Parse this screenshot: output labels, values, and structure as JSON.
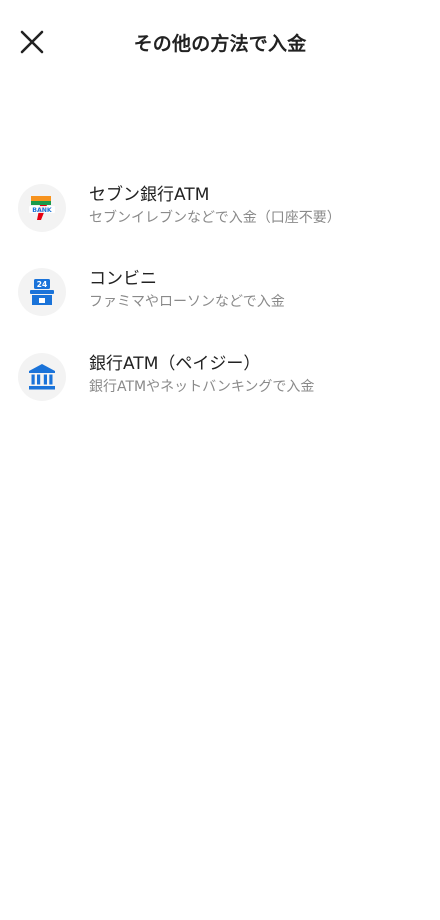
{
  "header": {
    "title": "その他の方法で入金",
    "close_icon": "close-icon"
  },
  "methods": [
    {
      "icon": "seven-bank-icon",
      "title": "セブン銀行ATM",
      "subtitle": "セブンイレブンなどで入金（口座不要）"
    },
    {
      "icon": "convenience-store-icon",
      "title": "コンビニ",
      "subtitle": "ファミマやローソンなどで入金"
    },
    {
      "icon": "bank-building-icon",
      "title": "銀行ATM（ペイジー）",
      "subtitle": "銀行ATMやネットバンキングで入金"
    }
  ],
  "icon_badges": {
    "seven_bank_text": "BANK",
    "convenience_hours": "24"
  },
  "colors": {
    "accent_blue": "#1a73d9",
    "seven_orange": "#f7931e",
    "seven_green": "#1a9a4b",
    "seven_red": "#e60012",
    "text_primary": "#222222",
    "text_secondary": "#8a8a8a",
    "icon_bg": "#f3f3f3"
  }
}
